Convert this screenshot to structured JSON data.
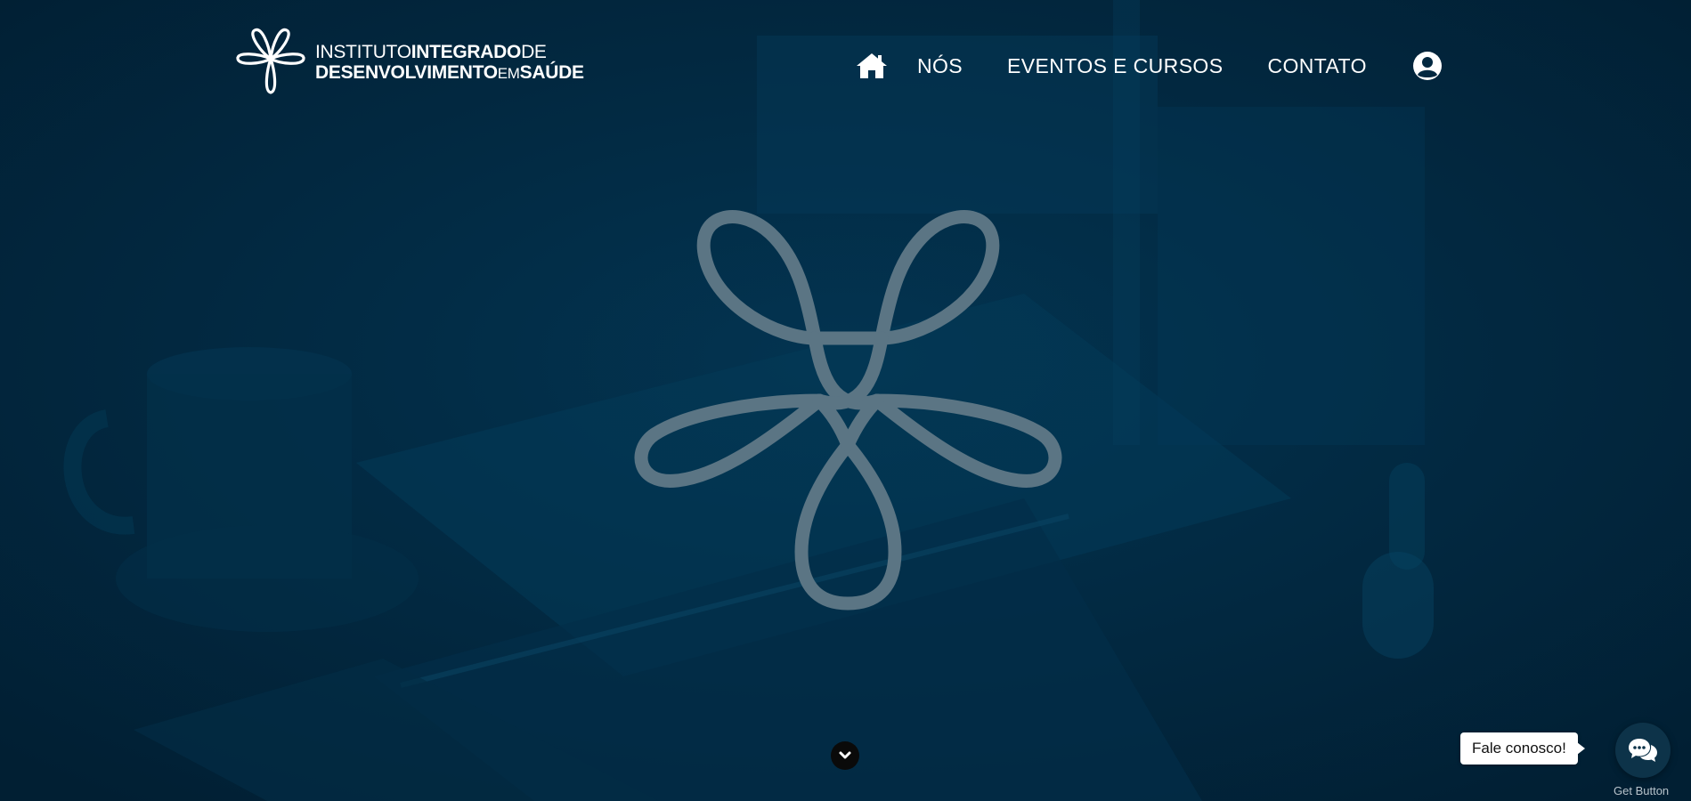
{
  "colors": {
    "background": "#022840",
    "nav_text": "#ffffff",
    "center_symbol": "#5b7584",
    "scroll_button": "#0a0a0a",
    "chat_button": "#0d3349"
  },
  "logo": {
    "icon": "quatrefoil-knot-logo-icon",
    "line1_light": "INSTITUTO",
    "line1_bold": "INTEGRADO",
    "line1_end": "DE",
    "line2_bold": "DESENVOLVIMENTO",
    "line2_small": "EM",
    "line2_end": "SAÚDE"
  },
  "nav": {
    "home_icon": "home-icon",
    "items": [
      {
        "label": "NÓS"
      },
      {
        "label": "EVENTOS E CURSOS"
      },
      {
        "label": "CONTATO"
      }
    ],
    "account_icon": "user-circle-icon"
  },
  "hero": {
    "symbol_icon": "quatrefoil-knot-symbol-icon",
    "scroll_icon": "chevron-down-icon"
  },
  "chat": {
    "label": "Fale conosco!",
    "icon": "chat-bubbles-icon",
    "powered_by": "Get Button"
  }
}
